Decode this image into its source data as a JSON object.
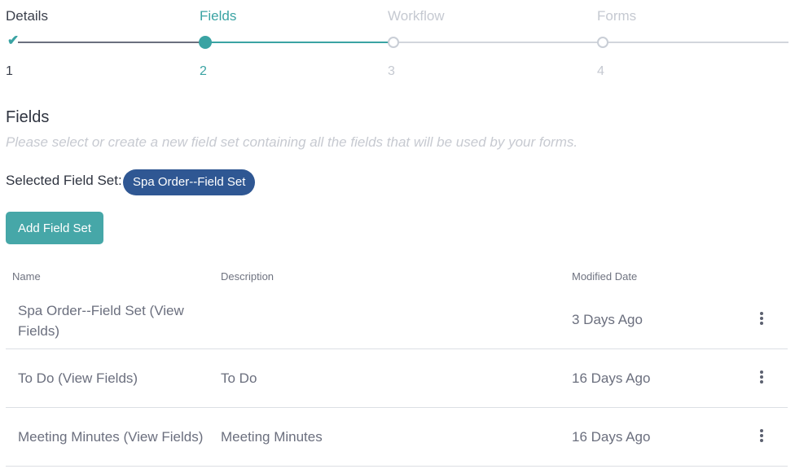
{
  "stepper": {
    "steps": [
      {
        "title": "Details",
        "number": "1"
      },
      {
        "title": "Fields",
        "number": "2"
      },
      {
        "title": "Workflow",
        "number": "3"
      },
      {
        "title": "Forms",
        "number": "4"
      }
    ],
    "colors": {
      "done": "#3aa3a3",
      "active": "#3aa3a3",
      "pending": "#c9ced6",
      "line_done": "#6b6f7e"
    }
  },
  "section": {
    "title": "Fields",
    "subtitle": "Please select or create a new field set containing all the fields that will be used by your forms.",
    "selected_label": "Selected Field Set:",
    "selected_value": "Spa Order--Field Set",
    "add_button": "Add Field Set"
  },
  "table": {
    "columns": {
      "name": "Name",
      "description": "Description",
      "modified": "Modified Date"
    },
    "rows": [
      {
        "name": "Spa Order--Field Set (View Fields)",
        "description": "",
        "modified": "3 Days Ago"
      },
      {
        "name": "To Do (View Fields)",
        "description": "To Do",
        "modified": "16 Days Ago"
      },
      {
        "name": "Meeting Minutes (View Fields)",
        "description": "Meeting Minutes",
        "modified": "16 Days Ago"
      }
    ]
  },
  "icons": {
    "done_step": "check-icon",
    "row_menu": "more-vertical-icon"
  }
}
